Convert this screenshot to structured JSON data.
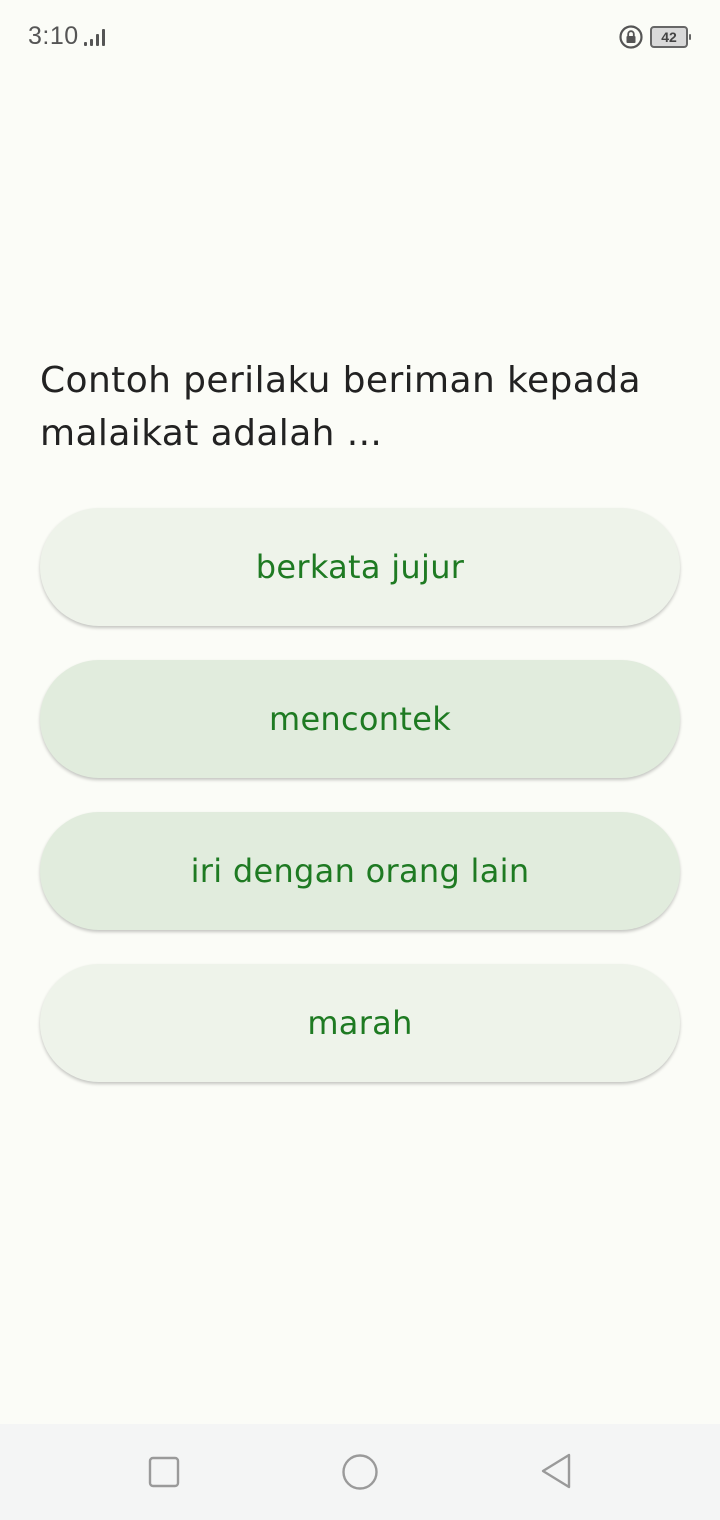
{
  "status_bar": {
    "time": "3:10",
    "battery_level": "42",
    "icons": [
      "signal-icon",
      "rotation-lock-icon",
      "battery-icon"
    ]
  },
  "quiz": {
    "question": "Contoh perilaku beriman kepada malaikat adalah ...",
    "answers": [
      {
        "label": "berkata jujur"
      },
      {
        "label": "mencontek"
      },
      {
        "label": "iri dengan orang lain"
      },
      {
        "label": "marah"
      }
    ]
  },
  "navigation_bar": {
    "icons": [
      "recent-apps-icon",
      "home-icon",
      "back-icon"
    ]
  },
  "colors": {
    "background": "#fbfcf7",
    "answer_text": "#1e7a22",
    "answer_light": "#eef3ea",
    "answer_mid": "#e1ecdd",
    "question_text": "#222222"
  }
}
